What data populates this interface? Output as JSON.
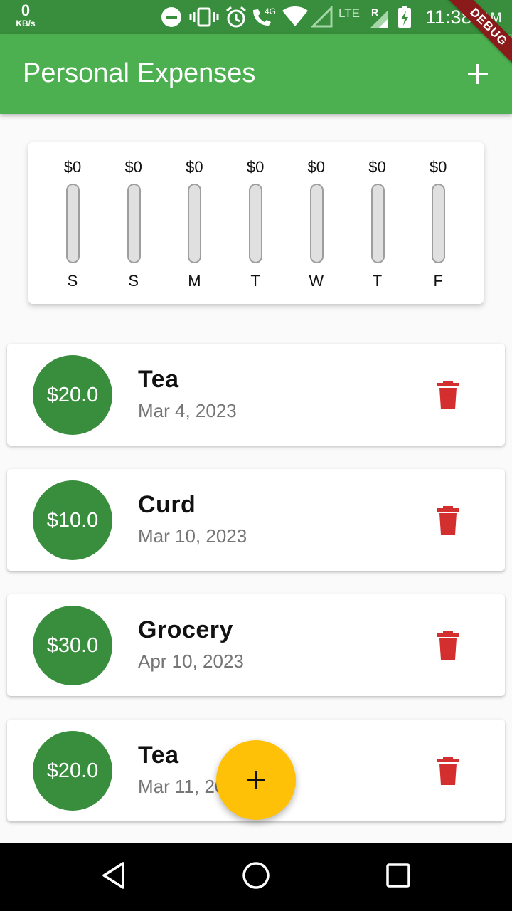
{
  "status_bar": {
    "network_speed": "0",
    "network_unit": "KB/s",
    "network_type": "4G",
    "lte_label": "LTE",
    "roaming_label": "R",
    "time": "11:38",
    "ampm": "AM"
  },
  "app_bar": {
    "title": "Personal Expenses",
    "add_icon": "plus-icon",
    "debug_label": "DEBUG"
  },
  "chart": {
    "bars": [
      {
        "amount": "$0",
        "day": "S",
        "fill_fraction": 0
      },
      {
        "amount": "$0",
        "day": "S",
        "fill_fraction": 0
      },
      {
        "amount": "$0",
        "day": "M",
        "fill_fraction": 0
      },
      {
        "amount": "$0",
        "day": "T",
        "fill_fraction": 0
      },
      {
        "amount": "$0",
        "day": "W",
        "fill_fraction": 0
      },
      {
        "amount": "$0",
        "day": "T",
        "fill_fraction": 0
      },
      {
        "amount": "$0",
        "day": "F",
        "fill_fraction": 0
      }
    ]
  },
  "transactions": [
    {
      "amount": "$20.0",
      "title": "Tea",
      "date": "Mar 4, 2023"
    },
    {
      "amount": "$10.0",
      "title": "Curd",
      "date": "Mar 10, 2023"
    },
    {
      "amount": "$30.0",
      "title": "Grocery",
      "date": "Apr 10, 2023"
    },
    {
      "amount": "$20.0",
      "title": "Tea",
      "date": "Mar 11, 2023"
    }
  ],
  "fab": {
    "icon": "plus-icon"
  },
  "nav_bar": {
    "back_icon": "back-triangle-icon",
    "home_icon": "home-circle-icon",
    "recents_icon": "recents-square-icon"
  },
  "colors": {
    "primary": "#4caf50",
    "primary_dark": "#388e3c",
    "accent": "#ffc107",
    "delete": "#d32f2f"
  }
}
